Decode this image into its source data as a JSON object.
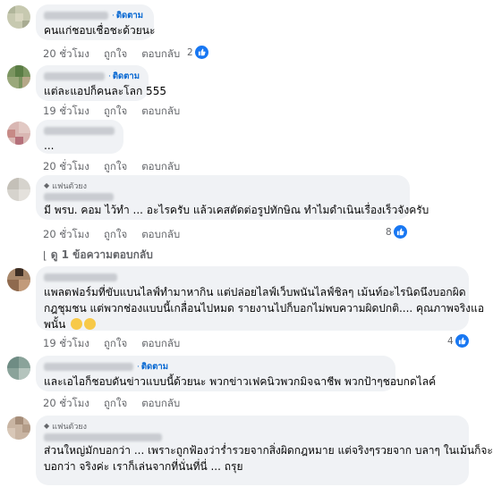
{
  "actions": {
    "time": "20 ชั่วโมง",
    "time19": "19 ชั่วโมง",
    "like": "ถูกใจ",
    "reply": "ตอบกลับ"
  },
  "comments": [
    {
      "follow": "ติดตาม",
      "text": "คนแก่ชอบเชื่อชะด้วยนะ",
      "time": "20 ชั่วโมง",
      "reactions": "2"
    },
    {
      "follow": "ติดตาม",
      "text": "แต่ละแอปก็คนละโลก 555",
      "time": "19 ชั่วโมง",
      "reactions": ""
    },
    {
      "follow": "",
      "text": "...",
      "time": "20 ชั่วโมง",
      "reactions": ""
    },
    {
      "badge": "แฟนตัวยง",
      "text": "มี พรบ. คอม ไว้ทำ ... อะไรครับ แล้วเคสตัดต่อรูปทักษิณ ทำไมดำเนินเรื่องเร็วจังครับ",
      "time": "20 ชั่วโมง",
      "reactions": "8"
    },
    {
      "text_lines": [
        "แพลตฟอร์มที่ขับแบนไลฟ์ทำมาหากิน แต่ปล่อยไลฟ์เว็บพนันไลฟ์ชิลๆ เม้นท์อะไรนิดนึงบอกผิด",
        "กฎชุมชน แต่พวกช่องแบบนี้เกลื่อนไปหมด รายงานไปก็บอกไม่พบความผิดปกติ.... คุณภาพจริงแอ",
        "พนั้น"
      ],
      "time": "19 ชั่วโมง",
      "reactions": "4"
    },
    {
      "follow": "ติดตาม",
      "text": "และเอไอก็ชอบดันข่าวแบบนี้ด้วยนะ พวกข่าวเฟคนิวพวกมิจฉาชีพ พวกป้าๆชอบกดไลค์",
      "time": "20 ชั่วโมง",
      "reactions": ""
    },
    {
      "badge": "แฟนตัวยง",
      "text_lines": [
        "ส่วนใหญ่มักบอกว่า ... เพราะถูกฟ้องว่าร่ำรวยจากสิ่งผิดกฎหมาย แต่จริงๆรวยจาก บลาๆ ในเม้นก็จะ",
        "บอกว่า จริงค่ะ เราก็เล่นจากที่นั่นที่นี่ ... ถรุย"
      ]
    }
  ],
  "view_replies": "ดู 1 ข้อความตอบกลับ"
}
